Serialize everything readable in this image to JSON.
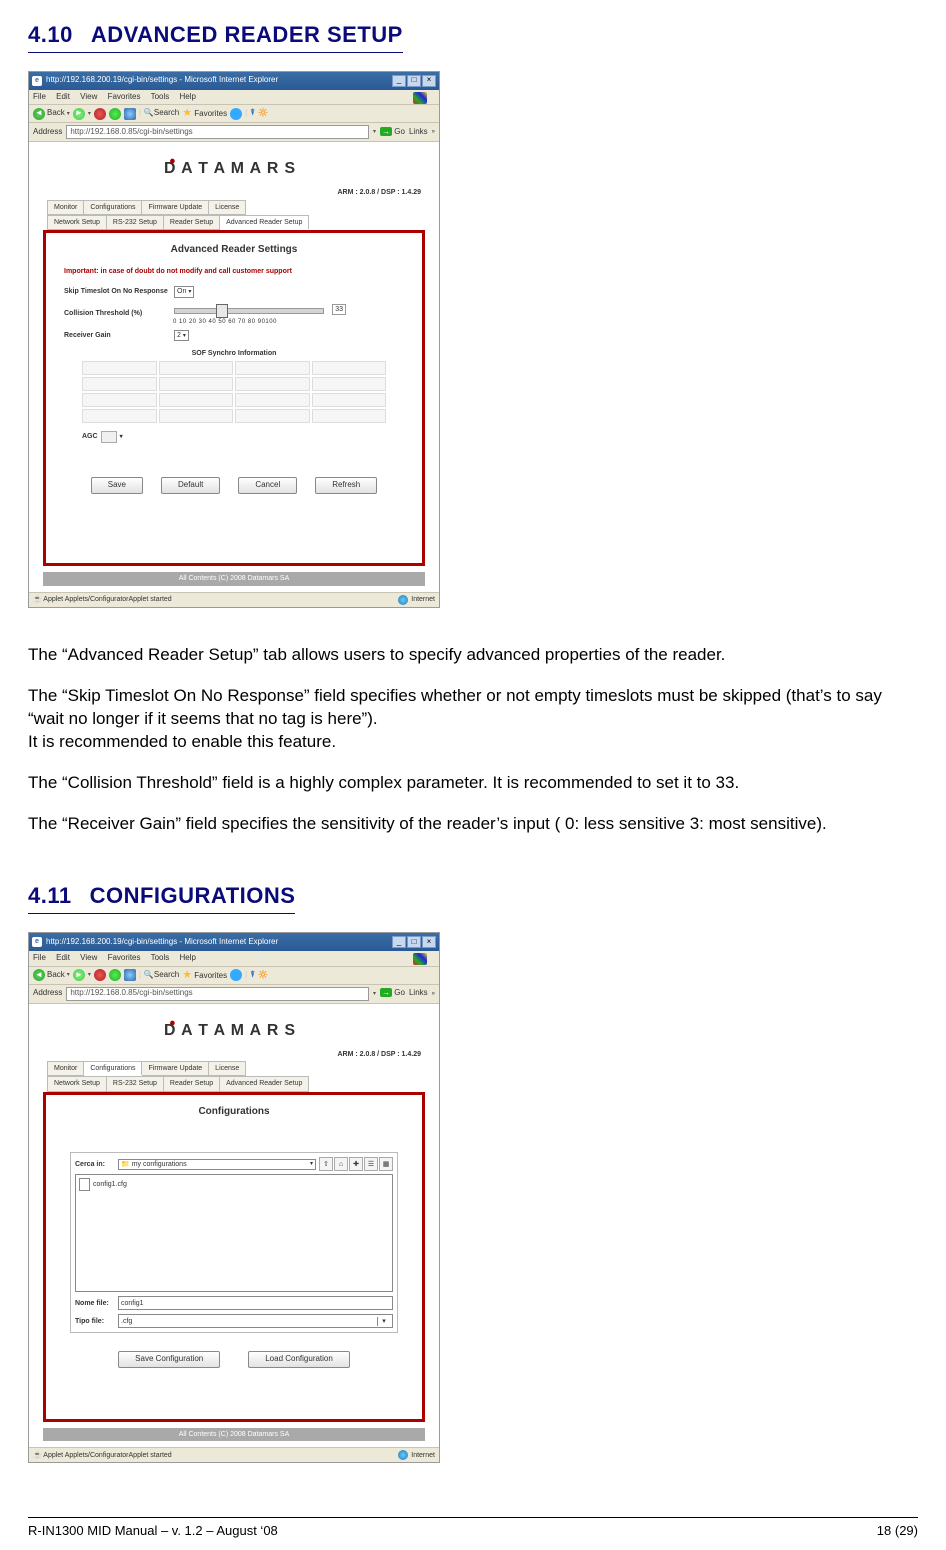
{
  "sections": {
    "s1": {
      "num": "4.10",
      "title": "ADVANCED READER SETUP"
    },
    "s2": {
      "num": "4.11",
      "title": "CONFIGURATIONS"
    }
  },
  "body_text": {
    "p1": "The “Advanced Reader Setup” tab allows users to specify advanced properties of the reader.",
    "p2": "The “Skip Timeslot On No Response” field specifies whether or not empty timeslots must be skipped (that’s to say “wait no longer if it seems that no tag is here”).",
    "p3": "It is recommended to enable this feature.",
    "p4": "The “Collision Threshold” field is a highly complex parameter.  It is recommended to set it to 33.",
    "p5": "The “Receiver Gain” field specifies the sensitivity of the reader’s input ( 0: less sensitive  3: most sensitive)."
  },
  "browser": {
    "title": "http://192.168.200.19/cgi-bin/settings - Microsoft Internet Explorer",
    "menus": [
      "File",
      "Edit",
      "View",
      "Favorites",
      "Tools",
      "Help"
    ],
    "back": "Back",
    "search": "Search",
    "favorites": "Favorites",
    "address_label": "Address",
    "address_value": "http://192.168.0.85/cgi-bin/settings",
    "go": "Go",
    "links": "Links",
    "status": "Applet Applets/ConfiguratorApplet started",
    "zone": "Internet"
  },
  "app": {
    "logo_text": "DATAMARS",
    "version": "ARM : 2.0.8 / DSP : 1.4.29",
    "tabs_row1": [
      "Monitor",
      "Configurations",
      "Firmware Update",
      "License"
    ],
    "tabs_row2": [
      "Network Setup",
      "RS-232 Setup",
      "Reader Setup",
      "Advanced Reader Setup"
    ],
    "footer": "All Contents (C) 2008 Datamars SA"
  },
  "shot1": {
    "panel_title": "Advanced Reader Settings",
    "warning": "Important: in case of doubt do not modify and call customer support",
    "field_skip": "Skip Timeslot On No Response",
    "field_skip_value": "On",
    "field_collision": "Collision Threshold (%)",
    "field_collision_value": "33",
    "ticks": "0  10 20 30 40 50 60 70 80 90100",
    "field_gain": "Receiver Gain",
    "field_gain_value": "2",
    "sof_title": "SOF Synchro Information",
    "agc_label": "AGC",
    "buttons": [
      "Save",
      "Default",
      "Cancel",
      "Refresh"
    ]
  },
  "shot2": {
    "selected_tab_row1_index": 1,
    "panel_title": "Configurations",
    "look_in_label": "Cerca in:",
    "look_in_value": "my configurations",
    "file_item": "config1.cfg",
    "name_label": "Nome file:",
    "name_value": "config1",
    "type_label": "Tipo file:",
    "type_value": ".cfg",
    "buttons": [
      "Save Configuration",
      "Load Configuration"
    ]
  },
  "page_footer": {
    "left": "R-IN1300 MID Manual  – v. 1.2 – August ‘08",
    "right": "18 (29)"
  }
}
